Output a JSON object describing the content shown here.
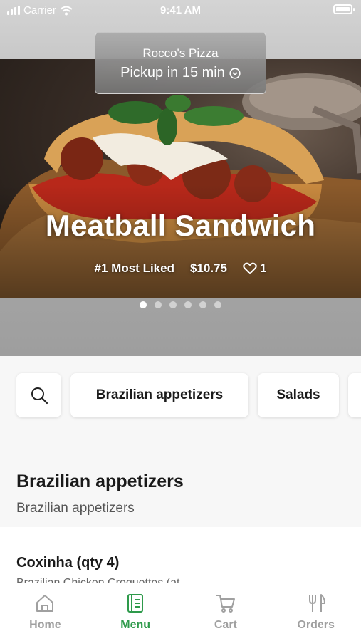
{
  "status_bar": {
    "carrier": "Carrier",
    "time": "9:41 AM"
  },
  "pickup": {
    "restaurant": "Rocco's Pizza",
    "label": "Pickup in 15 min"
  },
  "featured": {
    "title": "Meatball Sandwich",
    "badge": "#1 Most Liked",
    "price": "$10.75",
    "likes": "1",
    "carousel_count": 6,
    "carousel_active": 1
  },
  "categories": [
    "Brazilian appetizers",
    "Salads"
  ],
  "section": {
    "title": "Brazilian appetizers",
    "subtitle": "Brazilian appetizers"
  },
  "item": {
    "title": "Coxinha (qty 4)",
    "description": "Brazilian Chicken Croquettes (at"
  },
  "tabs": [
    {
      "label": "Home",
      "icon": "home-icon"
    },
    {
      "label": "Menu",
      "icon": "menu-book-icon",
      "active": true
    },
    {
      "label": "Cart",
      "icon": "cart-icon"
    },
    {
      "label": "Orders",
      "icon": "fork-knife-icon"
    }
  ],
  "colors": {
    "accent": "#2e9a4b",
    "inactive": "#a0a0a0"
  }
}
